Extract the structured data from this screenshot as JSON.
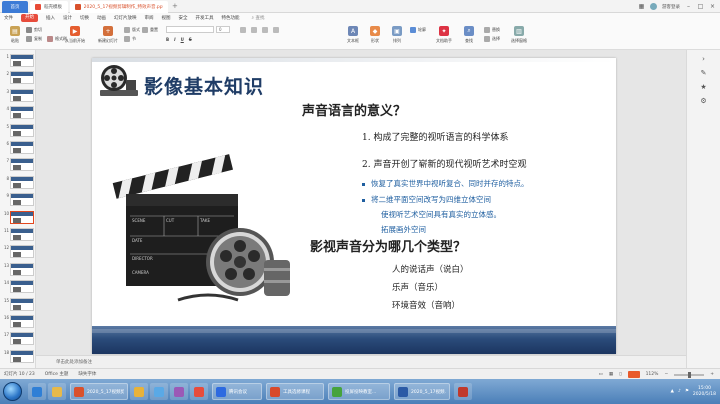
{
  "tabs": [
    {
      "label": "首页",
      "icon": "home-icon",
      "color": "#3c7bd6"
    },
    {
      "label": "稻壳模板",
      "icon": "docer-icon",
      "color": "#e84b36"
    },
    {
      "label": "2020_5_17视频剪辑制作_特效声音.pptx",
      "icon": "ppt-icon",
      "color": "#d9512c"
    }
  ],
  "title_right": {
    "user": "游客登录",
    "icons": [
      "grid-icon",
      "minimize-icon",
      "maximize-icon",
      "close-icon"
    ]
  },
  "menu": {
    "file": "文件",
    "items": [
      "开始",
      "插入",
      "设计",
      "切换",
      "动画",
      "幻灯片放映",
      "审阅",
      "视图",
      "安全",
      "开发工具",
      "特色功能"
    ],
    "search": "查找"
  },
  "ribbon": {
    "paste": "粘贴",
    "cut": "剪切",
    "copy": "复制",
    "format_painter": "格式刷",
    "from_current": "从当前开始",
    "new_slide": "新建幻灯片",
    "layout": "版式",
    "section": "节",
    "reset": "重置",
    "font_name": "",
    "font_size": "0",
    "bold": "B",
    "italic": "I",
    "underline": "U",
    "strike": "S",
    "textbox": "文本框",
    "shape": "形状",
    "arrange": "排列",
    "outline": "轮廓",
    "text_tools": "文档助手",
    "find": "查找",
    "replace": "替换",
    "select": "选择",
    "select_pane": "选择窗格"
  },
  "thumbnails": [
    {
      "num": "1"
    },
    {
      "num": "2"
    },
    {
      "num": "3"
    },
    {
      "num": "4"
    },
    {
      "num": "5"
    },
    {
      "num": "6"
    },
    {
      "num": "7"
    },
    {
      "num": "8"
    },
    {
      "num": "9"
    },
    {
      "num": "10",
      "selected": true
    },
    {
      "num": "11"
    },
    {
      "num": "12"
    },
    {
      "num": "13"
    },
    {
      "num": "14"
    },
    {
      "num": "15"
    },
    {
      "num": "16"
    },
    {
      "num": "17"
    },
    {
      "num": "18"
    }
  ],
  "slide": {
    "title": "影像基本知识",
    "heading1": "声音语言的意义？",
    "point1": "1. 构成了完整的视听语言的科学体系",
    "point2": "2. 声音开创了崭新的现代视听艺术时空观",
    "bullet1": "恢复了真实世界中视听复合、同时并存的特点。",
    "bullet2": "将二维平面空间改写为四维立体空间",
    "bullet2b": "使视听艺术空间具有真实的立体感。",
    "bullet3": "拓展画外空间",
    "heading2": "影视声音分为哪几个类型？",
    "type1": "人的说话声（说白）",
    "type2": "乐声（音乐）",
    "type3": "环境音效（音响）"
  },
  "notes_placeholder": "单击此处添加备注",
  "status": {
    "slide": "幻灯片 10 / 23",
    "theme": "Office 主题",
    "missing_font": "缺失字体",
    "zoom": "112%"
  },
  "taskbar": {
    "windows": [
      {
        "label": "2020_5_17视频剪...",
        "color": "#d9512c"
      },
      {
        "label": "腾讯会议",
        "color": "#2d6ae0"
      },
      {
        "label": "工具选修课程",
        "color": "#d84a2b"
      },
      {
        "label": "投屏投映教室...",
        "color": "#46a33c"
      },
      {
        "label": "2020_5_17视频...",
        "color": "#2b5aa5"
      }
    ],
    "time": "15:00",
    "date": "2020/5/18"
  },
  "colors": {
    "accent": "#e74c3c",
    "slide_title": "#1f3c66",
    "bullet": "#1f5fa0",
    "band": "#2b4c7b"
  }
}
